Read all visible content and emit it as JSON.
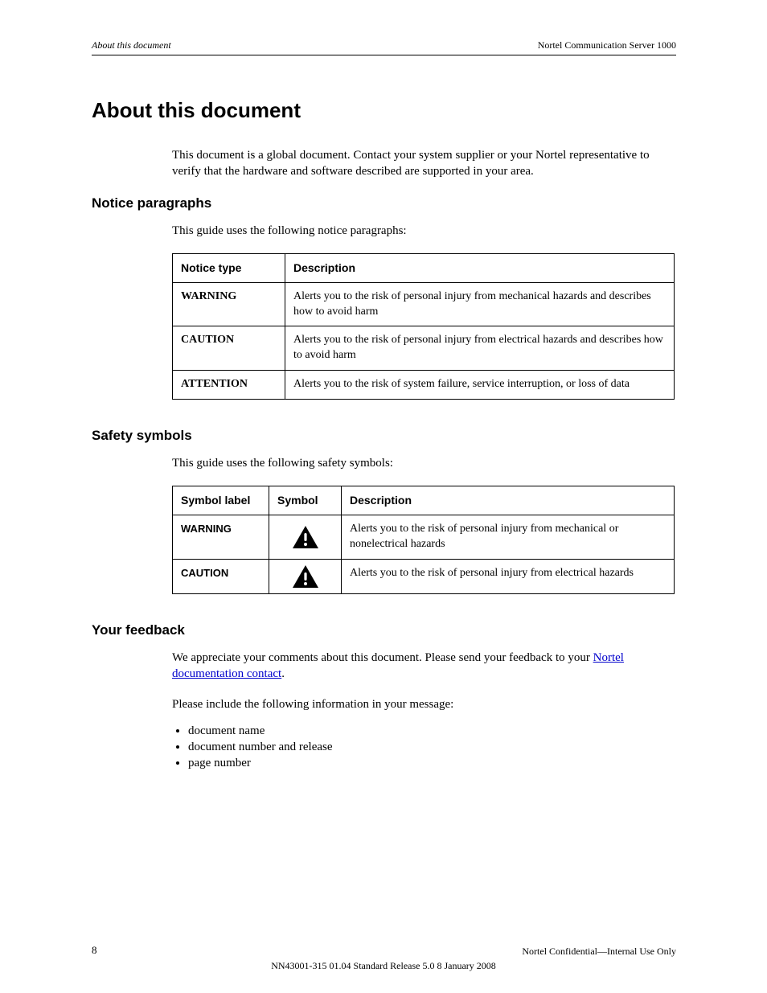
{
  "header": {
    "left_italic": "About this document",
    "right": "Nortel Communication Server 1000"
  },
  "title": "About this document",
  "intro": "This document is a global document. Contact your system supplier or your Nortel representative to verify that the hardware and software described are supported in your area.",
  "notice_heading": "Notice paragraphs",
  "notice_para": "This guide uses the following notice paragraphs:",
  "table1": {
    "headers": [
      "Notice type",
      "Description"
    ],
    "rows": [
      {
        "type": "WARNING",
        "desc": "Alerts you to the risk of personal injury from mechanical hazards and describes how to avoid harm"
      },
      {
        "type": "CAUTION",
        "desc": "Alerts you to the risk of personal injury from electrical hazards and describes how to avoid harm"
      },
      {
        "type": "ATTENTION",
        "desc": "Alerts you to the risk of system failure, service interruption, or loss of data"
      }
    ]
  },
  "safety_heading": "Safety symbols",
  "safety_para": "This guide uses the following safety symbols:",
  "table2": {
    "headers": [
      "Symbol label",
      "Symbol",
      "Description"
    ],
    "rows": [
      {
        "label": "WARNING",
        "desc": "Alerts you to the risk of personal injury from mechanical or nonelectrical hazards"
      },
      {
        "label": "CAUTION",
        "desc": "Alerts you to the risk of personal injury from electrical hazards"
      }
    ]
  },
  "feedback": {
    "heading": "Your feedback",
    "p1a": "We appreciate your comments about this document. Please send your feedback to your ",
    "p1_link_text": "Nortel documentation contact",
    "p1_link_href": "#",
    "p1b": ".",
    "p2": "Please include the following information in your message:",
    "bullets": [
      "document name",
      "document number and release",
      "page number"
    ]
  },
  "footer": {
    "page": "8",
    "confidential": "Nortel Confidential—Internal Use Only",
    "doc": "NN43001-315 01.04 Standard Release 5.0 8 January 2008"
  }
}
